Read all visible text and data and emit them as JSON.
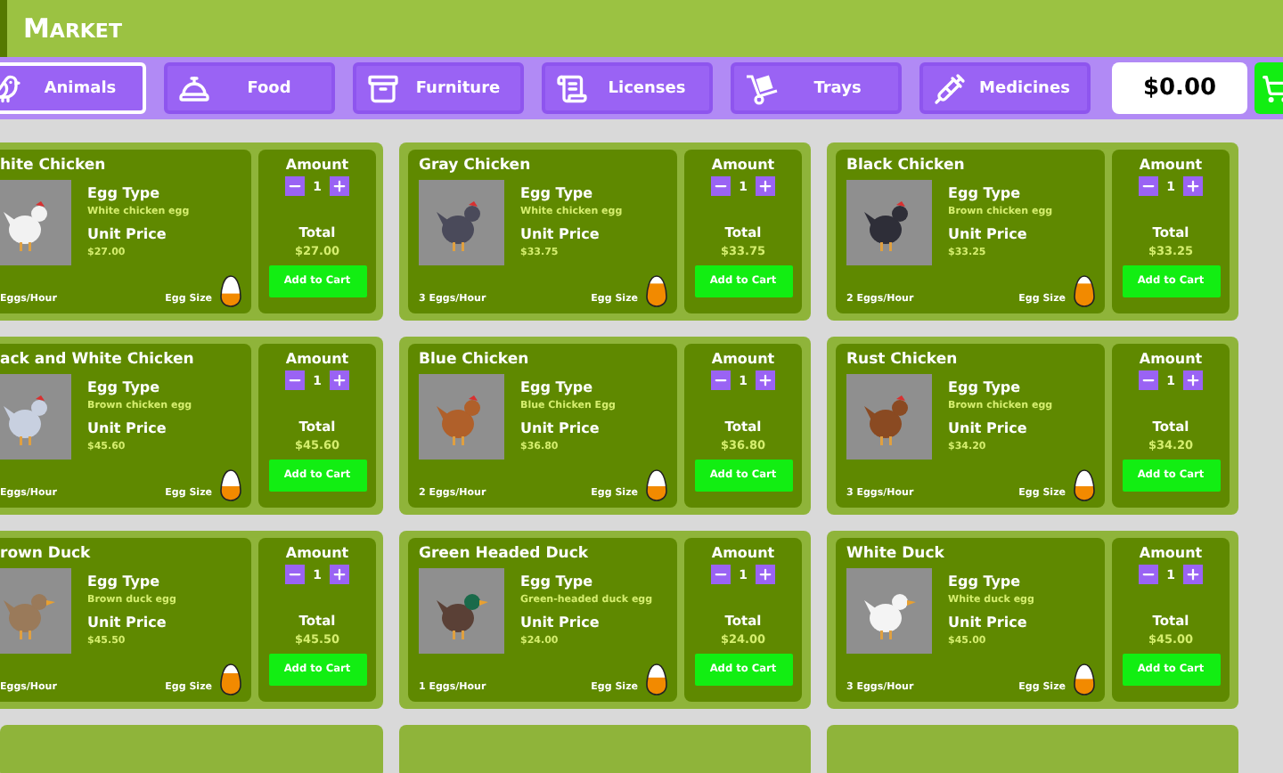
{
  "header": {
    "title": "Market"
  },
  "tabs": [
    {
      "label": "Animals",
      "selected": true
    },
    {
      "label": "Food",
      "selected": false
    },
    {
      "label": "Furniture",
      "selected": false
    },
    {
      "label": "Licenses",
      "selected": false
    },
    {
      "label": "Trays",
      "selected": false
    },
    {
      "label": "Medicines",
      "selected": false
    }
  ],
  "balance": "$0.00",
  "products": [
    {
      "name": "hite Chicken",
      "egg_type_label": "Egg Type",
      "egg_type": "White chicken egg",
      "unit_price_label": "Unit Price",
      "unit_price": "$27.00",
      "eggs_per_hour": "Eggs/Hour",
      "egg_size_label": "Egg Size",
      "amount_label": "Amount",
      "amount": "1",
      "total_label": "Total",
      "total": "$27.00",
      "button": "Add to Cart"
    },
    {
      "name": "Gray Chicken",
      "egg_type_label": "Egg Type",
      "egg_type": "White chicken egg",
      "unit_price_label": "Unit Price",
      "unit_price": "$33.75",
      "eggs_per_hour": "3 Eggs/Hour",
      "egg_size_label": "Egg Size",
      "amount_label": "Amount",
      "amount": "1",
      "total_label": "Total",
      "total": "$33.75",
      "button": "Add to Cart"
    },
    {
      "name": "Black Chicken",
      "egg_type_label": "Egg Type",
      "egg_type": "Brown chicken egg",
      "unit_price_label": "Unit Price",
      "unit_price": "$33.25",
      "eggs_per_hour": "2 Eggs/Hour",
      "egg_size_label": "Egg Size",
      "amount_label": "Amount",
      "amount": "1",
      "total_label": "Total",
      "total": "$33.25",
      "button": "Add to Cart"
    },
    {
      "name": "ack and White Chicken",
      "egg_type_label": "Egg Type",
      "egg_type": "Brown chicken egg",
      "unit_price_label": "Unit Price",
      "unit_price": "$45.60",
      "eggs_per_hour": "Eggs/Hour",
      "egg_size_label": "Egg Size",
      "amount_label": "Amount",
      "amount": "1",
      "total_label": "Total",
      "total": "$45.60",
      "button": "Add to Cart"
    },
    {
      "name": "Blue Chicken",
      "egg_type_label": "Egg Type",
      "egg_type": "Blue Chicken Egg",
      "unit_price_label": "Unit Price",
      "unit_price": "$36.80",
      "eggs_per_hour": "2 Eggs/Hour",
      "egg_size_label": "Egg Size",
      "amount_label": "Amount",
      "amount": "1",
      "total_label": "Total",
      "total": "$36.80",
      "button": "Add to Cart"
    },
    {
      "name": "Rust Chicken",
      "egg_type_label": "Egg Type",
      "egg_type": "Brown chicken egg",
      "unit_price_label": "Unit Price",
      "unit_price": "$34.20",
      "eggs_per_hour": "3 Eggs/Hour",
      "egg_size_label": "Egg Size",
      "amount_label": "Amount",
      "amount": "1",
      "total_label": "Total",
      "total": "$34.20",
      "button": "Add to Cart"
    },
    {
      "name": "rown Duck",
      "egg_type_label": "Egg Type",
      "egg_type": "Brown duck egg",
      "unit_price_label": "Unit Price",
      "unit_price": "$45.50",
      "eggs_per_hour": "Eggs/Hour",
      "egg_size_label": "Egg Size",
      "amount_label": "Amount",
      "amount": "1",
      "total_label": "Total",
      "total": "$45.50",
      "button": "Add to Cart"
    },
    {
      "name": "Green Headed Duck",
      "egg_type_label": "Egg Type",
      "egg_type": "Green-headed duck egg",
      "unit_price_label": "Unit Price",
      "unit_price": "$24.00",
      "eggs_per_hour": "1 Eggs/Hour",
      "egg_size_label": "Egg Size",
      "amount_label": "Amount",
      "amount": "1",
      "total_label": "Total",
      "total": "$24.00",
      "button": "Add to Cart"
    },
    {
      "name": "White Duck",
      "egg_type_label": "Egg Type",
      "egg_type": "White duck egg",
      "unit_price_label": "Unit Price",
      "unit_price": "$45.00",
      "eggs_per_hour": "3 Eggs/Hour",
      "egg_size_label": "Egg Size",
      "amount_label": "Amount",
      "amount": "1",
      "total_label": "Total",
      "total": "$45.00",
      "button": "Add to Cart"
    }
  ]
}
